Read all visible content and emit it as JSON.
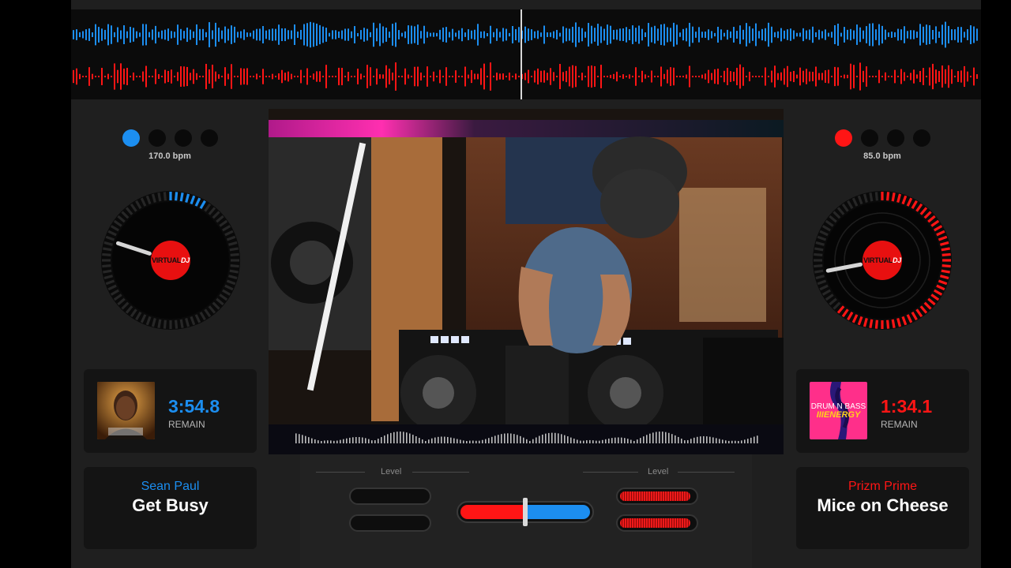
{
  "colors": {
    "deck_a": "#1c8ef0",
    "deck_b": "#ff1515",
    "panel": "#141414",
    "background": "#1f1f1f"
  },
  "deck_a": {
    "bpm_text": "170.0 bpm",
    "active_dot_index": 0,
    "platter_logo_main": "VIRTUAL",
    "platter_logo_accent": "DJ",
    "time_remaining": "3:54.8",
    "remain_label": "REMAIN",
    "artist": "Sean Paul",
    "title": "Get Busy",
    "cover_icon": "album-cover-portrait",
    "playback_position": 0.09
  },
  "deck_b": {
    "bpm_text": "85.0 bpm",
    "active_dot_index": 0,
    "platter_logo_main": "VIRTUAL",
    "platter_logo_accent": "DJ",
    "time_remaining": "1:34.1",
    "remain_label": "REMAIN",
    "cover_text_line1": "DRUM N BASS",
    "cover_text_line2": "IIIENERGY",
    "artist": "Prizm Prime",
    "title": "Mice on Cheese",
    "playback_position": 0.62
  },
  "mixer": {
    "level_label_left": "Level",
    "level_label_right": "Level",
    "deck_a_level": 0.0,
    "deck_b_level": 0.95,
    "crossfader_position": 0.5
  },
  "video": {
    "description_icon": "webcam-video-feed"
  }
}
